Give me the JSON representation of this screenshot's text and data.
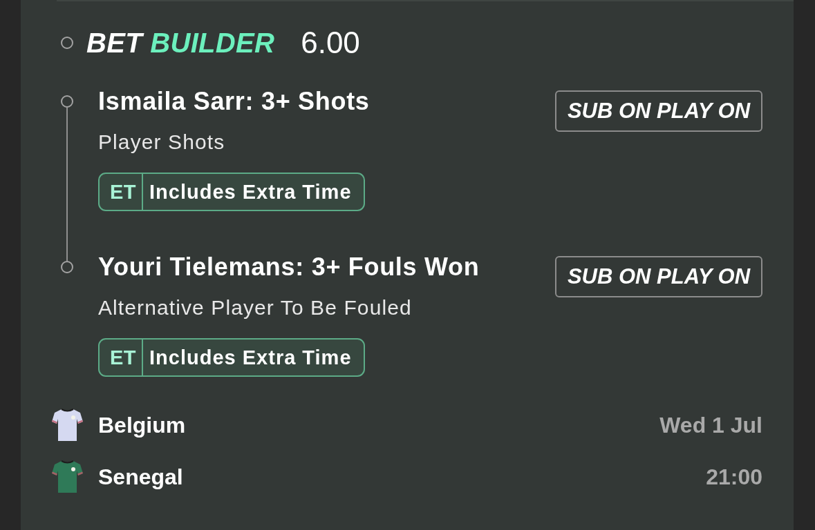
{
  "header": {
    "title": [
      {
        "text": "BET",
        "kind": "plain"
      },
      {
        "text": "BUILDER",
        "kind": "accent"
      }
    ],
    "odds": "6.00"
  },
  "legs": [
    {
      "selection": "Ismaila Sarr: 3+ Shots",
      "market": "Player Shots",
      "badge": {
        "code": "ET",
        "label": "Includes Extra Time"
      },
      "action": "SUB ON PLAY ON"
    },
    {
      "selection": "Youri Tielemans: 3+ Fouls Won",
      "market": "Alternative Player To Be Fouled",
      "badge": {
        "code": "ET",
        "label": "Includes Extra Time"
      },
      "action": "SUB ON PLAY ON"
    }
  ],
  "match": [
    {
      "team": "Belgium",
      "color": "#d5d9f1",
      "detail": "Wed 1 Jul"
    },
    {
      "team": "Senegal",
      "color": "#2f7a58",
      "detail": "21:00"
    }
  ]
}
